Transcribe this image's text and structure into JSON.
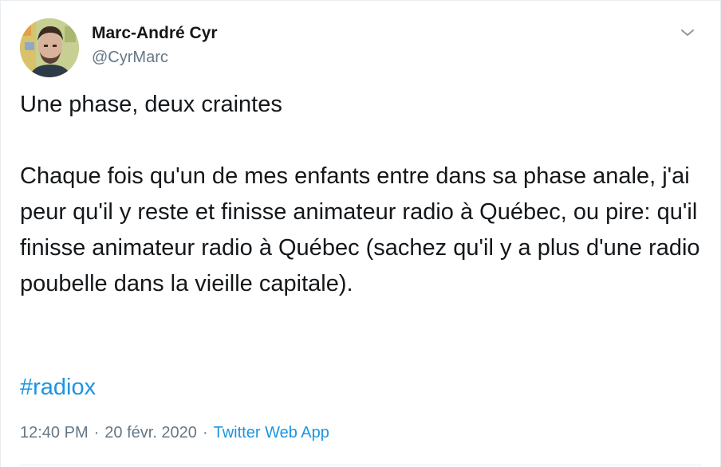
{
  "author": {
    "display_name": "Marc-André Cyr",
    "handle": "@CyrMarc"
  },
  "tweet": {
    "line1": "Une phase, deux craintes",
    "paragraph2": "Chaque fois qu'un de mes enfants entre dans sa phase anale, j'ai peur qu'il y reste et finisse animateur radio à Québec, ou pire: qu'il finisse animateur radio à Québec (sachez qu'il y a plus d'une radio poubelle dans la vieille capitale).",
    "hashtag": "#radiox"
  },
  "meta": {
    "time": "12:40 PM",
    "date": "20 févr. 2020",
    "source": "Twitter Web App",
    "separator": "·"
  },
  "icons": {
    "menu": "chevron-down-icon",
    "avatar": "avatar-image"
  },
  "colors": {
    "link": "#1b95e0",
    "secondary_text": "#657786",
    "primary_text": "#14171a",
    "border": "#e6ecf0"
  }
}
